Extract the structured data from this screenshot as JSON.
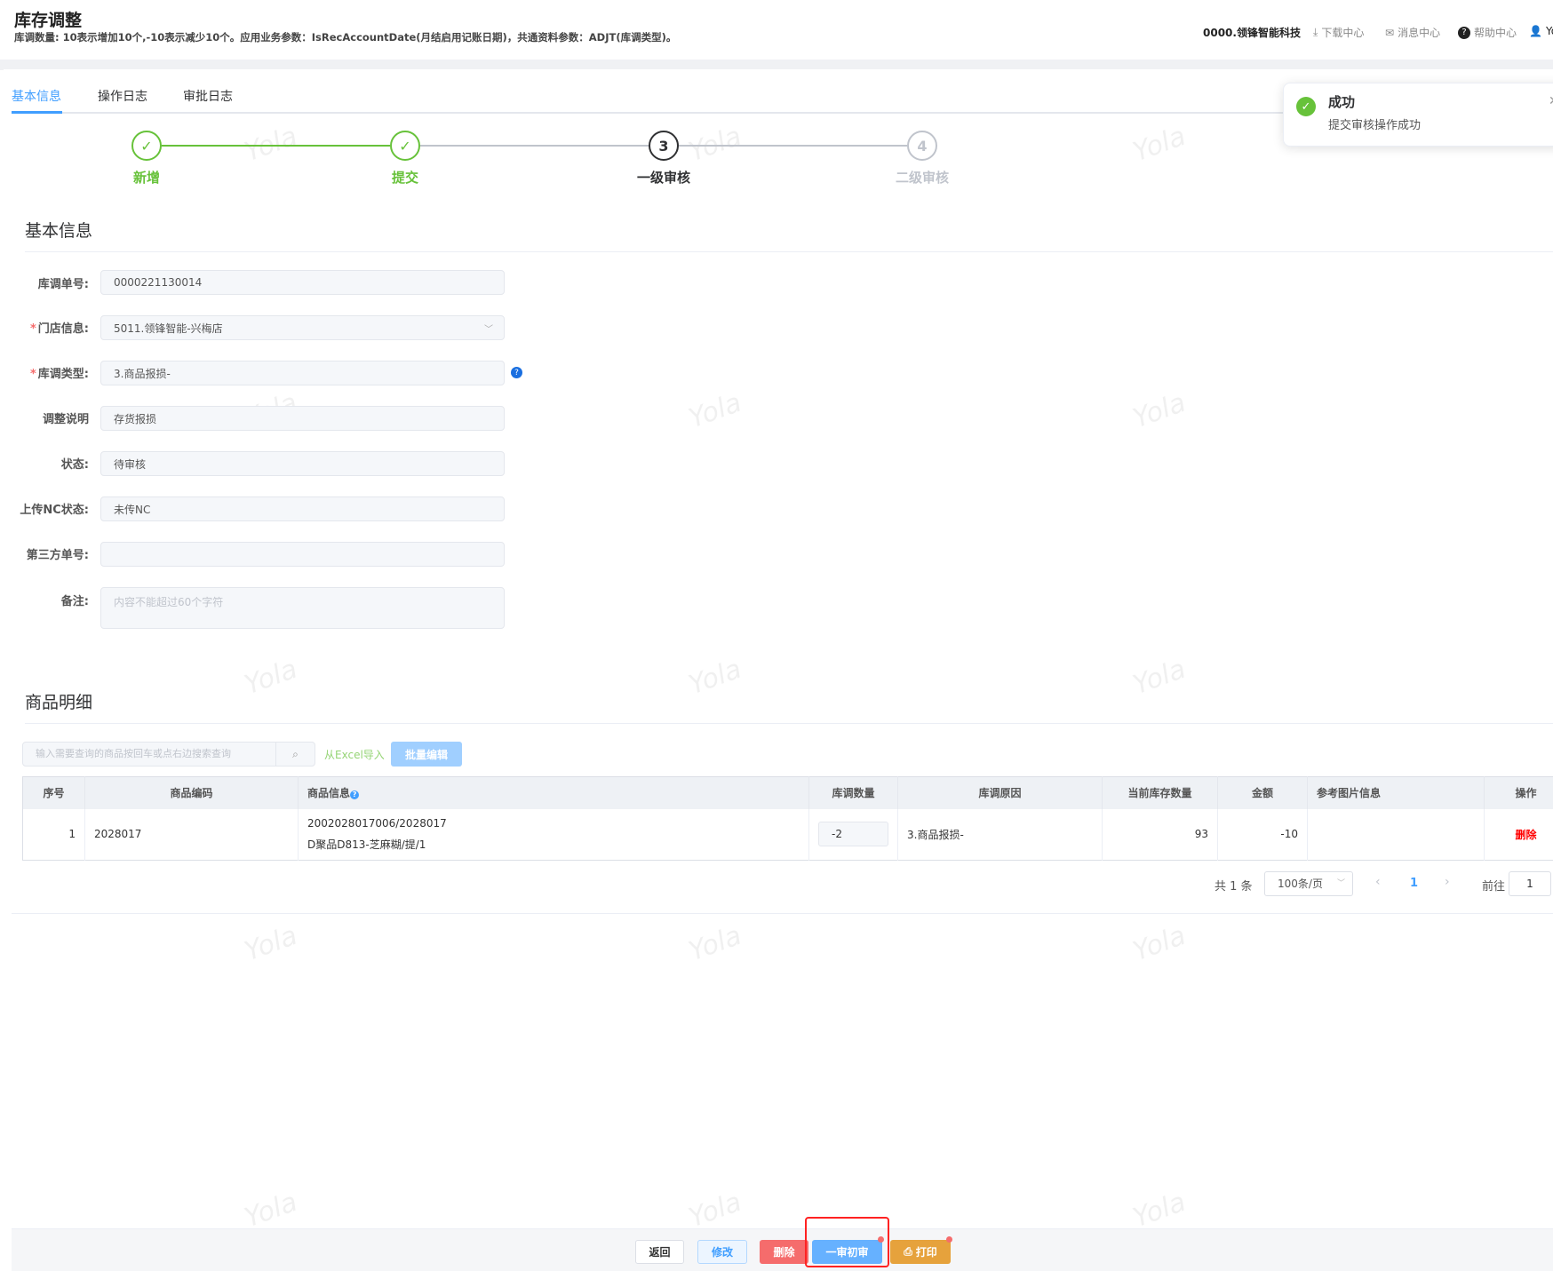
{
  "header": {
    "title": "库存调整",
    "subtitle": "库调数量: 10表示增加10个,-10表示减少10个。应用业务参数：IsRecAccountDate(月结启用记账日期)，共通资料参数：ADJT(库调类型)。",
    "company": "0000.领锋智能科技",
    "download": "下载中心",
    "messages": "消息中心",
    "help": "帮助中心",
    "user": "Yo"
  },
  "tabs": [
    {
      "label": "基本信息",
      "active": true
    },
    {
      "label": "操作日志"
    },
    {
      "label": "审批日志"
    }
  ],
  "toast": {
    "title": "成功",
    "message": "提交审核操作成功"
  },
  "steps": [
    {
      "label": "新增",
      "status": "done"
    },
    {
      "label": "提交",
      "status": "done"
    },
    {
      "label": "一级审核",
      "number": "3",
      "status": "current"
    },
    {
      "label": "二级审核",
      "number": "4",
      "status": "pending"
    }
  ],
  "basic": {
    "title": "基本信息",
    "fields": [
      {
        "label": "库调单号:",
        "value": "0000221130014"
      },
      {
        "label": "门店信息:",
        "value": "5011.领锋智能-兴梅店",
        "required": true
      },
      {
        "label": "库调类型:",
        "value": "3.商品报损-",
        "required": true
      },
      {
        "label": "调整说明",
        "value": "存货报损"
      },
      {
        "label": "状态:",
        "value": "待审核"
      },
      {
        "label": "上传NC状态:",
        "value": "未传NC"
      },
      {
        "label": "第三方单号:",
        "value": ""
      }
    ],
    "remark": {
      "label": "备注:",
      "placeholder": "内容不能超过60个字符"
    }
  },
  "detail": {
    "title": "商品明细",
    "search_placeholder": "输入需要查询的商品按回车或点右边搜索查询",
    "excel_import": "从Excel导入",
    "batch_edit": "批量编辑",
    "columns": [
      "序号",
      "商品编码",
      "商品信息",
      "库调数量",
      "库调原因",
      "当前库存数量",
      "金额",
      "参考图片信息",
      "操作"
    ],
    "rows": [
      {
        "index": "1",
        "code": "2028017",
        "info1": "2002028017006/2028017",
        "info2": "D聚品D813-芝麻糊/提/1",
        "qty": "-2",
        "reason": "3.商品报损-",
        "stock": "93",
        "amount": "-10",
        "image": "",
        "action": "删除"
      }
    ]
  },
  "pagination": {
    "total": "共 1 条",
    "page_size": "100条/页",
    "current": "1",
    "goto_label": "前往",
    "goto_value": "1"
  },
  "footer": {
    "back": "返回",
    "edit": "修改",
    "delete": "删除",
    "first_review": "一审初审",
    "print": "打印"
  },
  "watermark": "Yola",
  "colors": {
    "primary": "#409eff",
    "success": "#67c23a",
    "danger": "#f56c6c",
    "warning": "#e6a23c"
  }
}
